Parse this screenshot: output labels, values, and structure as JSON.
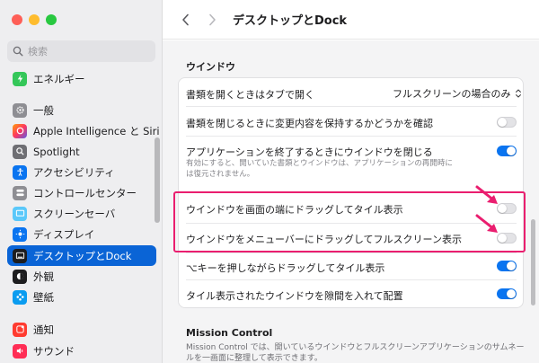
{
  "window": {
    "title": "デスクトップとDock"
  },
  "search": {
    "placeholder": "検索"
  },
  "sidebar": {
    "items": [
      {
        "label": "エネルギー",
        "icon": "energy-icon",
        "color": "#34c759"
      },
      {
        "label": "一般",
        "icon": "gear-icon",
        "color": "#8e8e93"
      },
      {
        "label": "Apple Intelligence と Siri",
        "icon": "siri-icon",
        "color": "#ff6b9a"
      },
      {
        "label": "Spotlight",
        "icon": "spotlight-icon",
        "color": "#7b7b80"
      },
      {
        "label": "アクセシビリティ",
        "icon": "accessibility-icon",
        "color": "#0a74f0"
      },
      {
        "label": "コントロールセンター",
        "icon": "control-center-icon",
        "color": "#8e8e93"
      },
      {
        "label": "スクリーンセーバ",
        "icon": "screensaver-icon",
        "color": "#5ac8fa"
      },
      {
        "label": "ディスプレイ",
        "icon": "display-icon",
        "color": "#0a74f0"
      },
      {
        "label": "デスクトップとDock",
        "icon": "dock-icon",
        "color": "#1d1d1f",
        "active": true
      },
      {
        "label": "外観",
        "icon": "appearance-icon",
        "color": "#1d1d1f"
      },
      {
        "label": "壁紙",
        "icon": "wallpaper-icon",
        "color": "#0a9cf0"
      },
      {
        "label": "通知",
        "icon": "notifications-icon",
        "color": "#ff3b30"
      },
      {
        "label": "サウンド",
        "icon": "sound-icon",
        "color": "#ff2d55"
      }
    ]
  },
  "main": {
    "section_title": "ウインドウ",
    "rows": [
      {
        "label": "書類を開くときはタブで開く",
        "control": "select",
        "value": "フルスクリーンの場合のみ"
      },
      {
        "label": "書類を閉じるときに変更内容を保持するかどうかを確認",
        "control": "toggle",
        "on": false
      },
      {
        "label": "アプリケーションを終了するときにウインドウを閉じる",
        "control": "toggle",
        "on": true,
        "description": "有効にすると、開いていた書類とウインドウは、アプリケーションの再開時には復元されません。"
      },
      {
        "label": "ウインドウを画面の端にドラッグしてタイル表示",
        "control": "toggle",
        "on": false
      },
      {
        "label": "ウインドウをメニューバーにドラッグしてフルスクリーン表示",
        "control": "toggle",
        "on": false
      },
      {
        "label": "⌥キーを押しながらドラッグしてタイル表示",
        "control": "toggle",
        "on": true
      },
      {
        "label": "タイル表示されたウインドウを隙間を入れて配置",
        "control": "toggle",
        "on": true
      }
    ],
    "section2_title": "Mission Control",
    "section2_desc": "Mission Control では、開いているウインドウとフルスクリーンアプリケーションのサムネールを一画面に整理して表示できます。"
  },
  "colors": {
    "accent": "#0a64d6",
    "highlight": "#ea1e6f",
    "toggle_on": "#0a74f0"
  }
}
